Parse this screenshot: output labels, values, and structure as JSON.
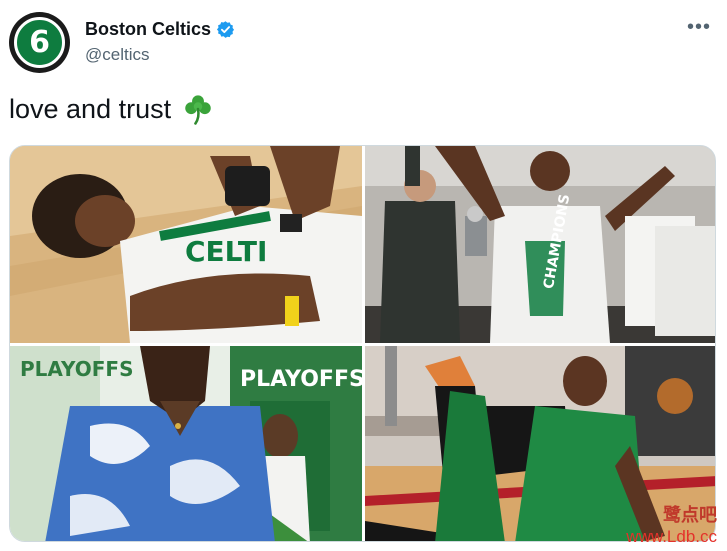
{
  "tweet": {
    "display_name": "Boston Celtics",
    "handle": "@celtics",
    "verified": true,
    "more_icon": "more-horizontal-icon",
    "text": "love and trust",
    "emoji": "shamrock",
    "avatar_number": "6"
  },
  "media": {
    "count": 4
  },
  "watermark": {
    "chinese": "鹭点吧",
    "url": "www.Ldb.cc"
  },
  "colors": {
    "celtics_green": "#0e7c3f",
    "verified_blue": "#1d9bf0",
    "handle_gray": "#536471"
  }
}
